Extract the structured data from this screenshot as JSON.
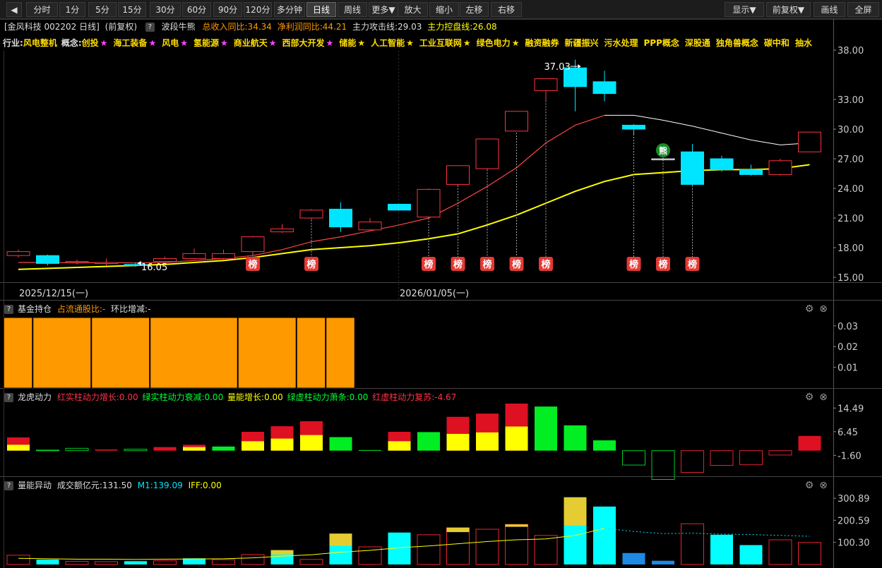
{
  "toolbar": {
    "back": "◀",
    "left_items": [
      {
        "label": "分时",
        "active": false
      },
      {
        "label": "1分",
        "active": false
      },
      {
        "label": "5分",
        "active": false
      },
      {
        "label": "15分",
        "active": false
      },
      {
        "label": "30分",
        "active": false
      },
      {
        "label": "60分",
        "active": false
      },
      {
        "label": "90分",
        "active": false
      },
      {
        "label": "120分",
        "active": false
      },
      {
        "label": "多分钟",
        "active": false
      },
      {
        "label": "日线",
        "active": true
      },
      {
        "label": "周线",
        "active": false
      },
      {
        "label": "更多▼",
        "active": false
      },
      {
        "label": "放大",
        "active": false
      },
      {
        "label": "缩小",
        "active": false
      },
      {
        "label": "左移",
        "active": false
      },
      {
        "label": "右移",
        "active": false
      }
    ],
    "right_items": [
      "显示▼",
      "前复权▼",
      "画线",
      "全屏"
    ]
  },
  "info": {
    "stock": "[金风科技 002202 日线]",
    "adj": "(前复权)",
    "help": "?",
    "indicator": "波段牛熊",
    "rev_yoy": "总收入同比:34.34",
    "profit_yoy": "净利润同比:44.21",
    "attack_line": "主力攻击线:29.03",
    "control_line": "主力控盘线:26.08"
  },
  "concepts": {
    "industry_label": "行业:",
    "industry": "风电整机",
    "concept_label": "概念:",
    "items": [
      {
        "text": "创投",
        "star": "★",
        "star_color": "#ff44ff"
      },
      {
        "text": "海工装备",
        "star": "★",
        "star_color": "#ff44ff"
      },
      {
        "text": "风电",
        "star": "★",
        "star_color": "#ff44ff"
      },
      {
        "text": "氢能源",
        "star": "★",
        "star_color": "#ff44ff"
      },
      {
        "text": "商业航天",
        "star": "★",
        "star_color": "#ff44ff"
      },
      {
        "text": "西部大开发",
        "star": "★",
        "star_color": "#ff44ff"
      },
      {
        "text": "储能",
        "star": "★",
        "star_color": "#ffdd00"
      },
      {
        "text": "人工智能",
        "star": "★",
        "star_color": "#ffdd00"
      },
      {
        "text": "工业互联网",
        "star": "★",
        "star_color": "#ffdd00"
      },
      {
        "text": "绿色电力",
        "star": "★",
        "star_color": "#ffdd00"
      },
      {
        "text": "融资融券",
        "star": "",
        "star_color": ""
      },
      {
        "text": "新疆振兴",
        "star": "",
        "star_color": ""
      },
      {
        "text": "污水处理",
        "star": "",
        "star_color": ""
      },
      {
        "text": "PPP概念",
        "star": "",
        "star_color": ""
      },
      {
        "text": "深股通",
        "star": "",
        "star_color": ""
      },
      {
        "text": "独角兽概念",
        "star": "",
        "star_color": ""
      },
      {
        "text": "碳中和",
        "star": "",
        "star_color": ""
      },
      {
        "text": "抽水",
        "star": "",
        "star_color": ""
      }
    ]
  },
  "colors": {
    "up": "#ff3344",
    "down": "#00e5ff",
    "ma_white": "#ffffff",
    "ma_yellow": "#ffff00",
    "bang": "#e53935",
    "fund": "#ff9900"
  },
  "chart_data": [
    {
      "type": "candlestick",
      "name": "main",
      "ylim": [
        14.5,
        39.5
      ],
      "yticks": [
        "38.00",
        "33.00",
        "30.00",
        "27.00",
        "24.00",
        "21.00",
        "18.00",
        "15.00"
      ],
      "ytick_values": [
        38,
        33,
        30,
        27,
        24,
        21,
        18,
        15
      ],
      "dates": [
        "2025/12/15(一)",
        "2026/01/05(一)"
      ],
      "date_index": [
        0,
        13
      ],
      "candles": [
        {
          "o": 17.2,
          "c": 17.6,
          "h": 17.8,
          "l": 17.0
        },
        {
          "o": 17.2,
          "c": 16.4,
          "h": 17.3,
          "l": 16.2
        },
        {
          "o": 16.5,
          "c": 16.6,
          "h": 16.8,
          "l": 16.3
        },
        {
          "o": 16.4,
          "c": 16.5,
          "h": 16.9,
          "l": 16.2
        },
        {
          "o": 16.3,
          "c": 16.2,
          "h": 16.5,
          "l": 16.05
        },
        {
          "o": 16.6,
          "c": 16.9,
          "h": 17.1,
          "l": 16.5
        },
        {
          "o": 16.9,
          "c": 17.4,
          "h": 17.9,
          "l": 16.8
        },
        {
          "o": 16.9,
          "c": 17.4,
          "h": 17.8,
          "l": 16.8
        },
        {
          "o": 17.6,
          "c": 19.1,
          "h": 19.2,
          "l": 17.4
        },
        {
          "o": 19.6,
          "c": 19.9,
          "h": 20.4,
          "l": 19.5
        },
        {
          "o": 21.0,
          "c": 21.8,
          "h": 21.9,
          "l": 20.8
        },
        {
          "o": 21.9,
          "c": 20.1,
          "h": 22.6,
          "l": 19.6
        },
        {
          "o": 19.8,
          "c": 20.6,
          "h": 21.0,
          "l": 19.7
        },
        {
          "o": 22.4,
          "c": 21.8,
          "h": 22.4,
          "l": 21.8
        },
        {
          "o": 21.1,
          "c": 23.9,
          "h": 24.0,
          "l": 21.0
        },
        {
          "o": 24.4,
          "c": 26.3,
          "h": 26.3,
          "l": 24.3
        },
        {
          "o": 26.0,
          "c": 29.0,
          "h": 29.0,
          "l": 25.9
        },
        {
          "o": 29.8,
          "c": 31.8,
          "h": 31.8,
          "l": 30.5
        },
        {
          "o": 33.9,
          "c": 35.1,
          "h": 35.1,
          "l": 32.9
        },
        {
          "o": 36.2,
          "c": 34.3,
          "h": 37.03,
          "l": 31.8
        },
        {
          "o": 34.8,
          "c": 33.6,
          "h": 35.9,
          "l": 32.8
        },
        {
          "o": 30.4,
          "c": 30.0,
          "h": 30.5,
          "l": 29.5
        },
        {
          "o": 27.0,
          "c": 27.0,
          "h": 27.1,
          "l": 26.9
        },
        {
          "o": 27.7,
          "c": 24.4,
          "h": 28.5,
          "l": 24.3
        },
        {
          "o": 27.0,
          "c": 25.9,
          "h": 27.3,
          "l": 25.7
        },
        {
          "o": 25.9,
          "c": 25.4,
          "h": 26.4,
          "l": 25.3
        },
        {
          "o": 25.4,
          "c": 26.8,
          "h": 27.0,
          "l": 25.3
        },
        {
          "o": 27.7,
          "c": 29.7,
          "h": 29.7,
          "l": 27.7
        }
      ],
      "ma_white": [
        16.5,
        16.5,
        16.45,
        16.5,
        16.45,
        16.5,
        16.7,
        16.9,
        17.2,
        17.8,
        18.6,
        19.1,
        19.7,
        20.3,
        21.0,
        22.5,
        24.2,
        26.1,
        28.6,
        30.4,
        31.4,
        31.4,
        30.9,
        30.3,
        29.6,
        28.9,
        28.4,
        28.6
      ],
      "ma_yellow": [
        15.8,
        15.9,
        16.0,
        16.1,
        16.2,
        16.3,
        16.5,
        16.7,
        17.0,
        17.4,
        17.8,
        18.0,
        18.2,
        18.5,
        18.9,
        19.4,
        20.3,
        21.3,
        22.5,
        23.7,
        24.7,
        25.4,
        25.6,
        25.8,
        25.9,
        25.9,
        26.0,
        26.4
      ],
      "bang": [
        8,
        10,
        14,
        15,
        16,
        17,
        18,
        21,
        22,
        23
      ],
      "bang_label": "榜",
      "high_label": "37.03",
      "low_label": "16.05",
      "bear_label": "熊",
      "bear_index": 22
    },
    {
      "type": "bar",
      "name": "fund",
      "title": "基金持仓",
      "label1": "占流通股比:-",
      "label2": "环比增减:-",
      "yticks": [
        "0.03",
        "0.02",
        "0.01"
      ],
      "ylim": [
        0,
        0.034
      ],
      "segments": [
        1,
        2,
        2,
        3,
        2,
        1,
        1
      ],
      "value": 0.034
    },
    {
      "type": "bar",
      "name": "longhu",
      "title": "龙虎动力",
      "l1": "红实柱动力增长:0.00",
      "l2": "绿实柱动力衰减:0.00",
      "l3": "量能增长:0.00",
      "l4": "绿虚柱动力萧条:0.00",
      "l5": "红虚柱动力复苏:-4.67",
      "yticks": [
        "14.49",
        "6.45",
        "-1.60"
      ],
      "ylim": [
        -8,
        16
      ],
      "bars": [
        {
          "t": "rs",
          "v": 4.5,
          "y": 2.0
        },
        {
          "t": "gh",
          "v": 0.2
        },
        {
          "t": "gh",
          "v": 0.8
        },
        {
          "t": "rs",
          "v": 0.4
        },
        {
          "t": "gh",
          "v": 0.5
        },
        {
          "t": "rs",
          "v": 1.2
        },
        {
          "t": "rs",
          "v": 2.0,
          "y": 1.2
        },
        {
          "t": "gs",
          "v": 1.4
        },
        {
          "t": "rs",
          "v": 6.4,
          "y": 3.2
        },
        {
          "t": "rs",
          "v": 8.3,
          "y": 4.1
        },
        {
          "t": "rs",
          "v": 10.0,
          "y": 5.3
        },
        {
          "t": "gs",
          "v": 4.6
        },
        {
          "t": "gs",
          "v": 0.2
        },
        {
          "t": "rs",
          "v": 6.4,
          "y": 3.2
        },
        {
          "t": "gs",
          "v": 6.3
        },
        {
          "t": "rs",
          "v": 11.5,
          "y": 5.7
        },
        {
          "t": "rs",
          "v": 12.6,
          "y": 6.2
        },
        {
          "t": "rs",
          "v": 16.0,
          "y": 8.2
        },
        {
          "t": "gs",
          "v": 15.0
        },
        {
          "t": "gs",
          "v": 8.6
        },
        {
          "t": "gs",
          "v": 3.5
        },
        {
          "t": "gh",
          "v": -4.9
        },
        {
          "t": "gh",
          "v": -9.8
        },
        {
          "t": "rh",
          "v": -7.4
        },
        {
          "t": "rh",
          "v": -5.0
        },
        {
          "t": "rh",
          "v": -4.8
        },
        {
          "t": "rh",
          "v": -1.5
        },
        {
          "t": "rs",
          "v": 5.0
        }
      ]
    },
    {
      "type": "bar",
      "name": "volume",
      "title": "量能异动",
      "amount": "成交额亿元:131.50",
      "m1": "M1:139.09",
      "iff": "IFF:0.00",
      "yticks": [
        "300.89",
        "200.59",
        "100.30"
      ],
      "ylim": [
        0,
        330
      ],
      "bars": [
        {
          "t": "rh",
          "v": 42
        },
        {
          "t": "cy",
          "v": 22
        },
        {
          "t": "rh",
          "v": 14
        },
        {
          "t": "rh",
          "v": 13
        },
        {
          "t": "cy",
          "v": 15
        },
        {
          "t": "rh",
          "v": 17
        },
        {
          "t": "cy",
          "v": 28
        },
        {
          "t": "rh",
          "v": 22
        },
        {
          "t": "rh",
          "v": 45
        },
        {
          "t": "cy",
          "v": 65,
          "y": 20
        },
        {
          "t": "rh",
          "v": 23
        },
        {
          "t": "cy",
          "v": 140,
          "y": 55
        },
        {
          "t": "rh",
          "v": 80
        },
        {
          "t": "cy",
          "v": 145
        },
        {
          "t": "rh",
          "v": 135
        },
        {
          "t": "rh",
          "v": 167,
          "y": 20
        },
        {
          "t": "rh",
          "v": 160
        },
        {
          "t": "rh",
          "v": 182,
          "y": 11
        },
        {
          "t": "rh",
          "v": 132
        },
        {
          "t": "cy",
          "v": 305,
          "y": 128
        },
        {
          "t": "cy",
          "v": 263
        },
        {
          "t": "bl",
          "v": 52
        },
        {
          "t": "bl",
          "v": 17
        },
        {
          "t": "rh",
          "v": 185
        },
        {
          "t": "cy",
          "v": 135
        },
        {
          "t": "cy",
          "v": 88
        },
        {
          "t": "rh",
          "v": 112
        },
        {
          "t": "rh",
          "v": 100
        }
      ],
      "m1_line": [
        28,
        26,
        24,
        24,
        23,
        24,
        25,
        26,
        30,
        38,
        44,
        56,
        64,
        76,
        84,
        94,
        104,
        112,
        116,
        132,
        164,
        150,
        140,
        142,
        138,
        136,
        132,
        128
      ],
      "m1_dash_from": 20
    }
  ]
}
